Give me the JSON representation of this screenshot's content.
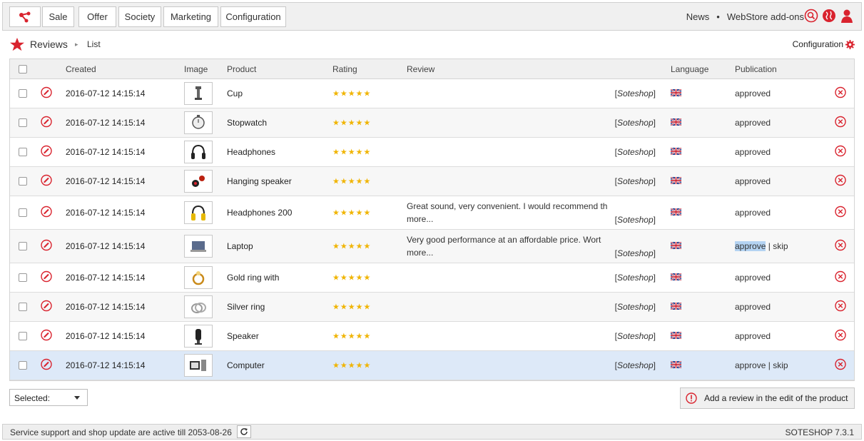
{
  "nav": {
    "tabs": [
      "Sale",
      "Offer",
      "Society",
      "Marketing",
      "Configuration"
    ],
    "links": [
      "News",
      "WebStore add-ons"
    ],
    "link_separator": "•"
  },
  "header": {
    "title": "Reviews",
    "breadcrumb_sep": "▸",
    "subtitle": "List",
    "config_label": "Configuration"
  },
  "table": {
    "columns": {
      "created": "Created",
      "image": "Image",
      "product": "Product",
      "rating": "Rating",
      "review": "Review",
      "language": "Language",
      "publication": "Publication"
    },
    "rows": [
      {
        "created": "2016-07-12 14:15:14",
        "product": "Cup",
        "rating": 5,
        "review": "",
        "review_more": "",
        "source": "Soteshop",
        "publication": "approved"
      },
      {
        "created": "2016-07-12 14:15:14",
        "product": "Stopwatch",
        "rating": 5,
        "review": "",
        "review_more": "",
        "source": "Soteshop",
        "publication": "approved"
      },
      {
        "created": "2016-07-12 14:15:14",
        "product": "Headphones",
        "rating": 5,
        "review": "",
        "review_more": "",
        "source": "Soteshop",
        "publication": "approved"
      },
      {
        "created": "2016-07-12 14:15:14",
        "product": "Hanging speaker",
        "rating": 5,
        "review": "",
        "review_more": "",
        "source": "Soteshop",
        "publication": "approved"
      },
      {
        "created": "2016-07-12 14:15:14",
        "product": "Headphones 200",
        "rating": 5,
        "review": "Great sound, very convenient. I would recommend th",
        "review_more": "more...",
        "source": "Soteshop",
        "publication": "approved"
      },
      {
        "created": "2016-07-12 14:15:14",
        "product": "Laptop",
        "rating": 5,
        "review": "Very good performance at an affordable price. Wort",
        "review_more": "more...",
        "source": "Soteshop",
        "publication": "",
        "approve": "approve",
        "skip": "skip",
        "pub_sep": "|"
      },
      {
        "created": "2016-07-12 14:15:14",
        "product": "Gold ring with",
        "rating": 5,
        "review": "",
        "review_more": "",
        "source": "Soteshop",
        "publication": "approved"
      },
      {
        "created": "2016-07-12 14:15:14",
        "product": "Silver ring",
        "rating": 5,
        "review": "",
        "review_more": "",
        "source": "Soteshop",
        "publication": "approved"
      },
      {
        "created": "2016-07-12 14:15:14",
        "product": "Speaker",
        "rating": 5,
        "review": "",
        "review_more": "",
        "source": "Soteshop",
        "publication": "approved"
      },
      {
        "created": "2016-07-12 14:15:14",
        "product": "Computer",
        "rating": 5,
        "review": "",
        "review_more": "",
        "source": "Soteshop",
        "publication": "",
        "approve": "approve",
        "skip": "skip",
        "pub_sep": "|"
      }
    ]
  },
  "footer": {
    "selected_label": "Selected:",
    "add_review_label": "Add a review in the edit of the product",
    "status_text": "Service support and shop update are active till 2053-08-26",
    "version": "SOTESHOP 7.3.1"
  },
  "colors": {
    "accent_red": "#d9232e",
    "star_gold": "#f0b400",
    "selected_row": "#dde9f8"
  }
}
